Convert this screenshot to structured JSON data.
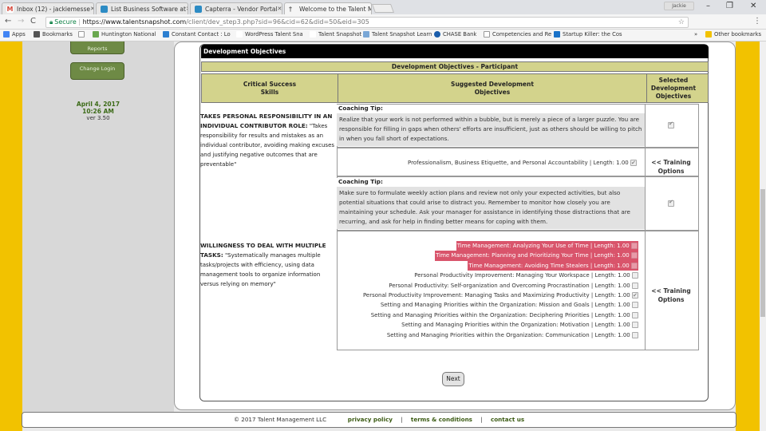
{
  "browser": {
    "tabs": [
      {
        "label": "Inbox (12) - jackiemesse",
        "icon_color": "#d44638"
      },
      {
        "label": "List Business Software at",
        "icon_color": "#2c8bc4"
      },
      {
        "label": "Capterra - Vendor Portal",
        "icon_color": "#2c8bc4"
      },
      {
        "label": "Welcome to the Talent M",
        "icon_color": "#ffffff"
      }
    ],
    "user_chip": "Jackie",
    "url_secure": "Secure",
    "url_domain": "https://www.talentsnapshot.com",
    "url_path": "/client/dev_step3.php?sid=96&cid=62&did=50&eid=305",
    "bookmarks": [
      {
        "label": "Apps",
        "color": "#4285f4"
      },
      {
        "label": "Bookmarks",
        "color": "#555555"
      },
      {
        "label": "",
        "color": "#999999"
      },
      {
        "label": "Huntington National",
        "color": "#6aa84f"
      },
      {
        "label": "Constant Contact : Lo",
        "color": "#2c7fd0"
      },
      {
        "label": "WordPress Talent Sna",
        "color": "#666666"
      },
      {
        "label": "Talent Snapshot",
        "color": "#666666"
      },
      {
        "label": "Talent Snapshot Learn",
        "color": "#7aa7d6"
      },
      {
        "label": "CHASE Bank",
        "color": "#1a5dab"
      },
      {
        "label": "Competencies and Re",
        "color": "#999999"
      },
      {
        "label": "Startup Killer: the Cos",
        "color": "#1a73c9"
      }
    ],
    "more_bookmarks": "»",
    "other_bookmarks": "Other bookmarks"
  },
  "sidebar": {
    "reports_label": "Reports",
    "change_login_label": "Change Login",
    "date": "April 4, 2017",
    "time": "10:26 AM",
    "version": "ver 3.50"
  },
  "section": {
    "title": "Development Objectives",
    "subtitle": "Development Objectives - Participant",
    "col_skills": "Critical Success Skills",
    "col_suggested": "Suggested Development Objectives",
    "col_selected": "Selected Development Objectives"
  },
  "skills": [
    {
      "title": "TAKES PERSONAL RESPONSIBILITY IN AN INDIVIDUAL CONTRIBUTOR ROLE:",
      "description": "\"Takes responsibility for results and mistakes as an individual contributor, avoiding making excuses and justifying negative outcomes that are preventable\"",
      "coaching_label": "Coaching Tip:",
      "coaching_tip": "Realize that your work is not performed within a bubble, but is merely a piece of a larger puzzle. You are responsible for filling in gaps when others' efforts are insufficient, just as others should be willing to pitch in when you fall short of expectations.",
      "tip_checked": true,
      "options": [
        {
          "label": "Professionalism, Business Etiquette, and Personal Accountability | Length: 1.00",
          "checked": true,
          "highlight": false
        }
      ],
      "training_label": "<< Training Options"
    },
    {
      "title": "WILLINGNESS TO DEAL WITH MULTIPLE TASKS:",
      "description": "\"Systematically manages multiple tasks/projects with efficiency, using data management tools to organize information versus relying on memory\"",
      "coaching_label": "Coaching Tip:",
      "coaching_tip": "Make sure to formulate weekly action plans and review not only your expected activities, but also potential situations that could arise to distract you. Remember to monitor how closely you are maintaining your schedule. Ask your manager for assistance in identifying those distractions that are recurring, and ask for help in finding better means for coping with them.",
      "tip_checked": true,
      "options": [
        {
          "label": "Time Management: Analyzing Your Use of Time | Length: 1.00",
          "checked": false,
          "highlight": true
        },
        {
          "label": "Time Management: Planning and Prioritizing Your Time | Length: 1.00",
          "checked": false,
          "highlight": true
        },
        {
          "label": "Time Management: Avoiding Time Stealers | Length: 1.00",
          "checked": false,
          "highlight": true
        },
        {
          "label": "Personal Productivity Improvement: Managing Your Workspace | Length: 1.00",
          "checked": false,
          "highlight": false
        },
        {
          "label": "Personal Productivity: Self-organization and Overcoming Procrastination | Length: 1.00",
          "checked": false,
          "highlight": false
        },
        {
          "label": "Personal Productivity Improvement: Managing Tasks and Maximizing Productivity | Length: 1.00",
          "checked": true,
          "highlight": false
        },
        {
          "label": "Setting and Managing Priorities within the Organization: Mission and Goals | Length: 1.00",
          "checked": false,
          "highlight": false
        },
        {
          "label": "Setting and Managing Priorities within the Organization: Deciphering Priorities | Length: 1.00",
          "checked": false,
          "highlight": false
        },
        {
          "label": "Setting and Managing Priorities within the Organization: Motivation | Length: 1.00",
          "checked": false,
          "highlight": false
        },
        {
          "label": "Setting and Managing Priorities within the Organization: Communication | Length: 1.00",
          "checked": false,
          "highlight": false
        }
      ],
      "training_label": "<< Training Options"
    }
  ],
  "next_label": "Next",
  "footer": {
    "copyright": "© 2017 Talent Management LLC",
    "privacy": "privacy policy",
    "terms": "terms & conditions",
    "contact": "contact us",
    "separator": "|"
  },
  "colors": {
    "accent_yellow": "#f2c200",
    "header_olive": "#d3d38c",
    "highlight_red": "#d9546b",
    "green_button": "#6e8a45"
  }
}
